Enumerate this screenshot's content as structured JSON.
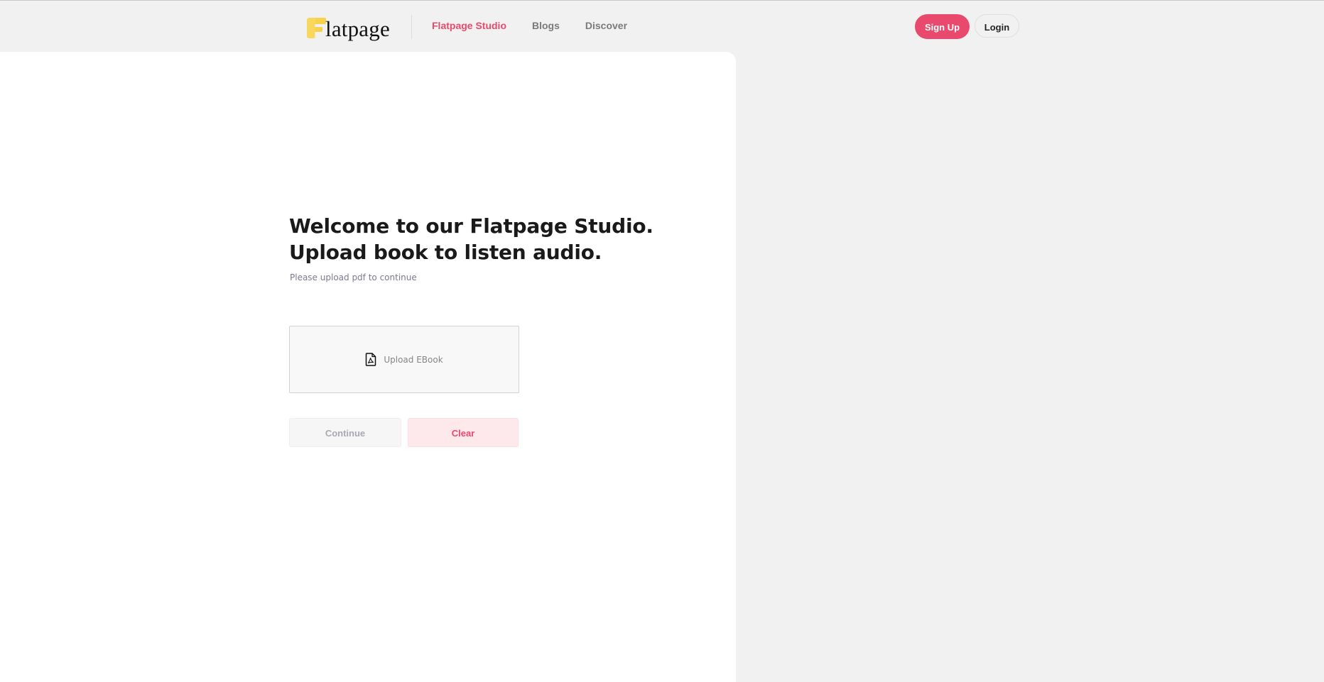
{
  "header": {
    "logo_text": "latpage",
    "nav": {
      "studio": "Flatpage Studio",
      "blogs": "Blogs",
      "discover": "Discover"
    },
    "signup_label": "Sign Up",
    "login_label": "Login"
  },
  "main": {
    "headline_line1": "Welcome to our Flatpage Studio.",
    "headline_line2": "Upload book to listen audio.",
    "subtext": "Please upload pdf to continue",
    "upload_label": "Upload EBook",
    "continue_label": "Continue",
    "clear_label": "Clear"
  },
  "icons": {
    "logo": "flatpage-logo-icon",
    "upload": "pdf-file-icon"
  },
  "colors": {
    "accent": "#e8496c",
    "logo_yellow": "#f7d24a",
    "page_bg": "#f1f1f1",
    "panel_bg": "#ffffff",
    "clear_bg": "#fde8ec"
  }
}
